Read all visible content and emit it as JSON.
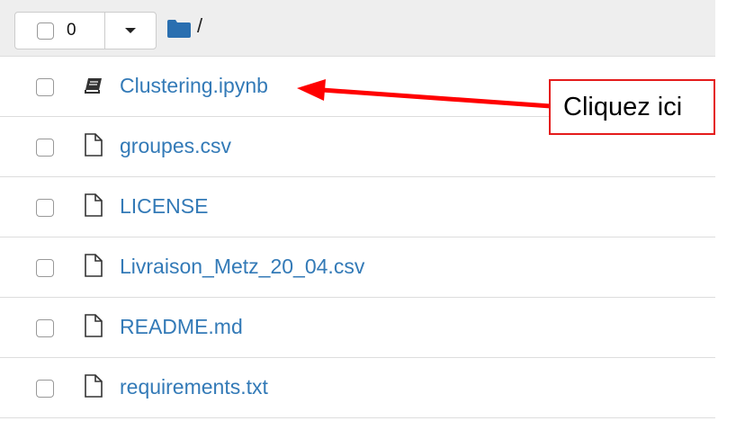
{
  "toolbar": {
    "selected_count": "0",
    "path_separator": "/",
    "folder_icon": "folder-icon",
    "dropdown_icon": "caret-down-icon"
  },
  "files": [
    {
      "name": "Clustering.ipynb",
      "icon": "notebook-icon"
    },
    {
      "name": "groupes.csv",
      "icon": "file-icon"
    },
    {
      "name": "LICENSE",
      "icon": "file-icon"
    },
    {
      "name": "Livraison_Metz_20_04.csv",
      "icon": "file-icon"
    },
    {
      "name": "README.md",
      "icon": "file-icon"
    },
    {
      "name": "requirements.txt",
      "icon": "file-icon"
    }
  ],
  "annotation": {
    "text": "Cliquez ici",
    "border_color": "#e41b1b",
    "arrow_color": "#ff0000"
  },
  "colors": {
    "link": "#337ab7",
    "header_bg": "#eeeeee",
    "folder": "#2a6fb0"
  }
}
